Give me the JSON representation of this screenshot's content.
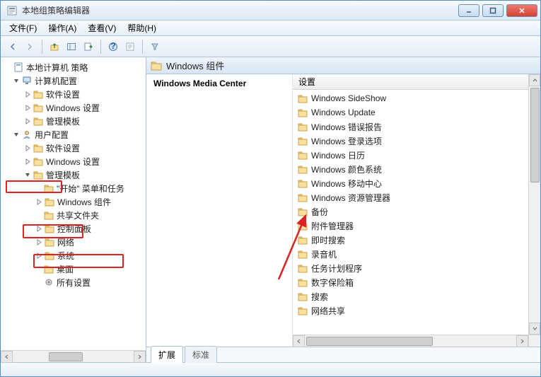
{
  "window": {
    "title": "本地组策略编辑器"
  },
  "menu": {
    "file": "文件(F)",
    "action": "操作(A)",
    "view": "查看(V)",
    "help": "帮助(H)"
  },
  "tree": {
    "root": "本地计算机 策略",
    "computer_config": "计算机配置",
    "cc_software": "软件设置",
    "cc_windows": "Windows 设置",
    "cc_templates": "管理模板",
    "user_config": "用户配置",
    "uc_software": "软件设置",
    "uc_windows": "Windows 设置",
    "uc_templates": "管理模板",
    "start_menu": "\"开始\" 菜单和任务",
    "windows_components": "Windows 组件",
    "shared_folders": "共享文件夹",
    "control_panel": "控制面板",
    "network": "网络",
    "system": "系统",
    "desktop": "桌面",
    "all_settings": "所有设置"
  },
  "right": {
    "header_title": "Windows 组件",
    "desc_title": "Windows Media Center",
    "list_header": "设置",
    "items": [
      "Windows SideShow",
      "Windows Update",
      "Windows 错误报告",
      "Windows 登录选项",
      "Windows 日历",
      "Windows 颜色系统",
      "Windows 移动中心",
      "Windows 资源管理器",
      "备份",
      "附件管理器",
      "即时搜索",
      "录音机",
      "任务计划程序",
      "数字保险箱",
      "搜索",
      "网络共享"
    ]
  },
  "tabs": {
    "extended": "扩展",
    "standard": "标准"
  }
}
